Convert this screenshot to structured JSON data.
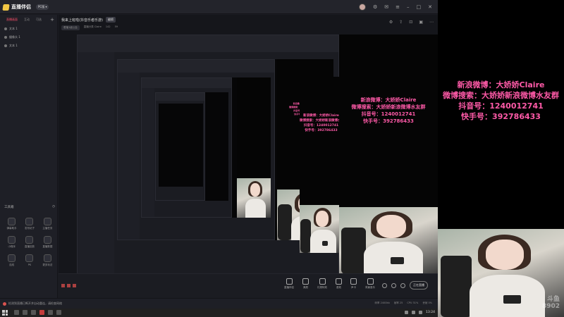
{
  "app": {
    "name": "直播伴侣",
    "version_badge": "PC版 ▾"
  },
  "sidebar": {
    "tabs": [
      "直播画面",
      "互动",
      "可选"
    ],
    "scenes": [
      {
        "label": "文本 1"
      },
      {
        "label": "摄像头 1"
      },
      {
        "label": "文本 1"
      }
    ],
    "toolbox_title": "工具箱",
    "tools": [
      "弹幕助手",
      "发布帖子",
      "主播任务",
      "小程序",
      "直播回放",
      "直播数据",
      "连线",
      "PK",
      "更多玩法"
    ]
  },
  "main": {
    "room_title": "我来上班啦(抖音乐者乐游)",
    "room_tag": "编辑",
    "meta": [
      "看播1级公会",
      "直播分类 Claire",
      "142",
      "59"
    ],
    "header_icons": [
      "settings-icon",
      "share-icon",
      "lock-icon",
      "layout-icon",
      "more-icon"
    ]
  },
  "stream_text": {
    "lines": [
      "新浪微博：大娇娇Claire",
      "微博搜索：大娇娇新浪微博水友群",
      "抖音号：1240012741",
      "快手号：392786433"
    ]
  },
  "bottombar": {
    "tools": [
      "直播伴侣",
      "美颜",
      "礼物特效",
      "音效",
      "声卡",
      "背景音乐"
    ],
    "live_button": "正在直播",
    "status_icons": [
      "mic-icon",
      "speaker-icon",
      "camera-icon",
      "settings-icon"
    ]
  },
  "app_status": {
    "notice": "检测到直播已断开并自动重连，请检查网络",
    "stats": [
      "码率 2400kb",
      "帧率 25",
      "CPU 31%",
      "丢帧 0%"
    ]
  },
  "taskbar": {
    "time": "13:24",
    "tray_icons": [
      "network-icon",
      "volume-icon",
      "ime-icon"
    ]
  },
  "overlay": {
    "text_lines": [
      "新浪微博：大娇娇Claire",
      "微博搜索：大娇娇新浪微博水友群",
      "抖音号：1240012741",
      "快手号：392786433"
    ],
    "watermark_line1": "斗鱼",
    "watermark_line2": "8902",
    "text_color": "#ff5aa8"
  }
}
